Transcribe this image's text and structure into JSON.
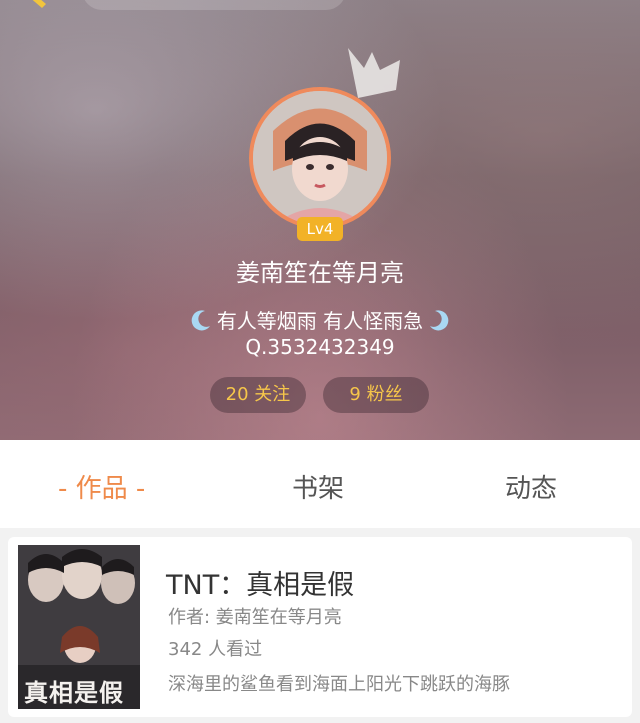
{
  "profile": {
    "username": "姜南笙在等月亮",
    "level": "Lv4",
    "bio": "有人等烟雨 有人怪雨急",
    "qq": "Q.3532432349",
    "following": "20 关注",
    "fans": "9   粉丝"
  },
  "tabs": {
    "works": "- 作品 -",
    "bookshelf": "书架",
    "activity": "动态"
  },
  "book": {
    "title": "TNT：真相是假",
    "author": "作者: 姜南笙在等月亮",
    "views": "342  人看过",
    "description": "深海里的鲨鱼看到海面上阳光下跳跃的海豚",
    "cover_text": "真相是假"
  },
  "colors": {
    "accent": "#ef8a4a",
    "level_badge": "#f2b227",
    "stat_text": "#f6c64a"
  },
  "icons": [
    "pencil-icon",
    "crown-icon",
    "moon-icon"
  ]
}
